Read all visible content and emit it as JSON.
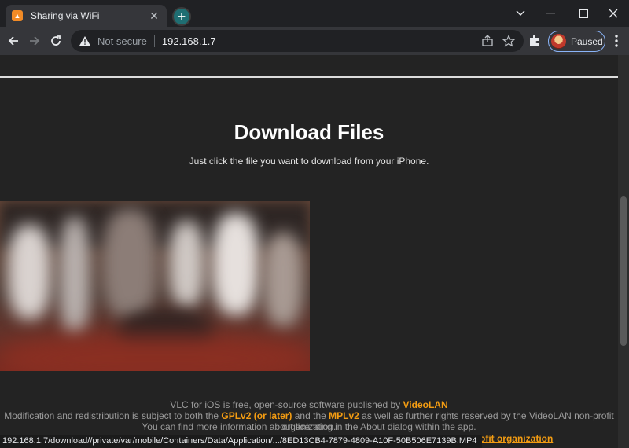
{
  "browser": {
    "tab": {
      "title": "Sharing via WiFi",
      "favicon": "vlc-cone-icon"
    },
    "address": {
      "security": "Not secure",
      "url": "192.168.1.7"
    },
    "profile": {
      "label": "Paused"
    },
    "status_url": "192.168.1.7/download//private/var/mobile/Containers/Data/Application/.../8ED13CB4-7879-4809-A10F-50B506E7139B.MP4"
  },
  "page": {
    "title": "Download Files",
    "subtitle": "Just click the file you want to download from your iPhone.",
    "footer": {
      "line1_prefix": "VLC for iOS is free, open-source software published by ",
      "line1_link": "VideoLAN",
      "line2_prefix": "Modification and redistribution is subject to both the ",
      "line2_link1": "GPLv2 (or later)",
      "line2_mid": " and the ",
      "line2_link2": "MPLv2",
      "line2_suffix": " as well as further rights reserved by the VideoLAN non-profit organization.",
      "line3": "You can find more information about licensing in the About dialog within the app.",
      "line4_link_fragment": "non-profit organization"
    }
  },
  "colors": {
    "accent_link": "#f39c12",
    "page_bg": "#232323",
    "chrome_bg": "#202124",
    "toolbar_bg": "#35363a"
  }
}
